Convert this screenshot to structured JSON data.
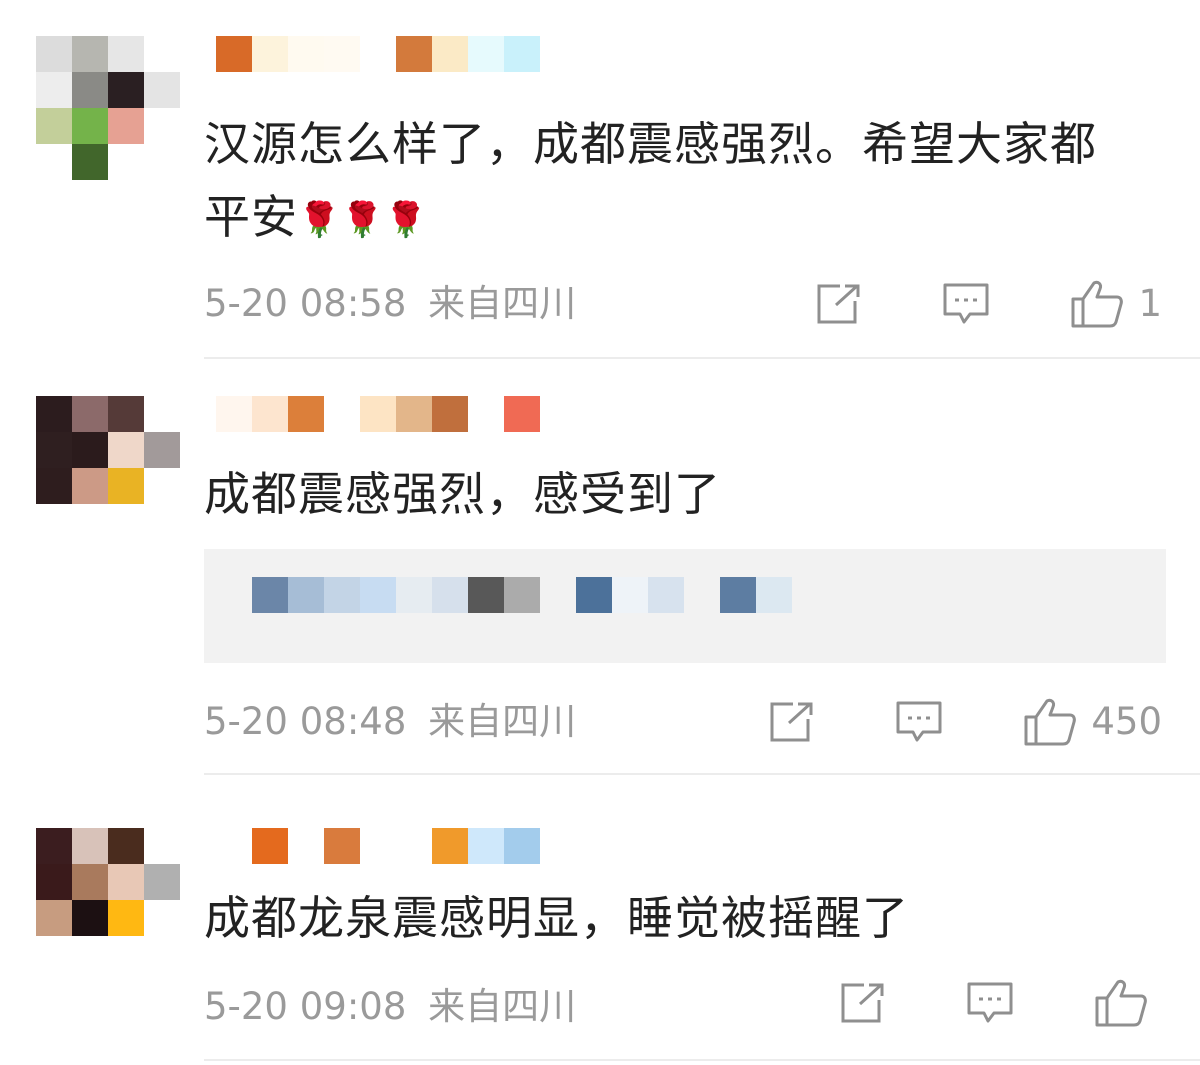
{
  "comments": [
    {
      "text_line1": "汉源怎么样了，成都震感强烈。希望大家都",
      "text_line2": "平安",
      "emoji": "🌹🌹🌹",
      "time": "5-20 08:58",
      "location": "来自四川",
      "likes": "1"
    },
    {
      "text_line1": "成都震感强烈，感受到了",
      "time": "5-20 08:48",
      "location": "来自四川",
      "likes": "450"
    },
    {
      "text_line1": "成都龙泉震感明显，睡觉被摇醒了",
      "time": "5-20 09:08",
      "location": "来自四川",
      "likes": ""
    }
  ],
  "icons": {
    "share": "share-icon",
    "comment": "comment-icon",
    "like": "thumbs-up-icon"
  },
  "colors": {
    "text": "#222222",
    "meta": "#9a9a9a",
    "divider": "#ececec",
    "reply_bg": "#f2f2f2"
  }
}
